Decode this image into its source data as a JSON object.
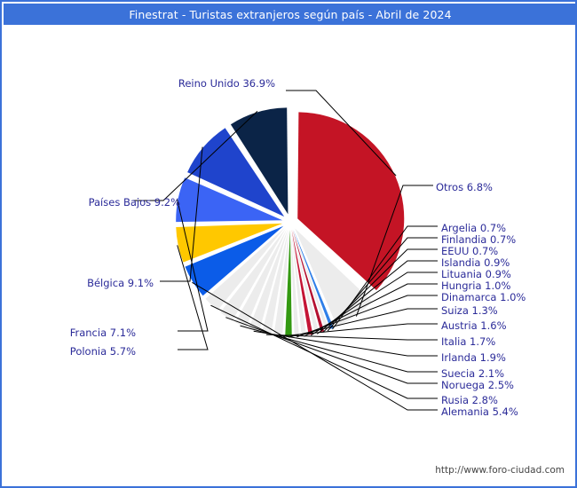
{
  "window": {
    "title": "Finestrat - Turistas extranjeros según país - Abril de 2024"
  },
  "footer": {
    "watermark": "http://www.foro-ciudad.com"
  },
  "colors": {
    "header_bg": "#3b72d9",
    "header_text": "#ffffff",
    "border": "#3b72d9",
    "label_text": "#2b2b99",
    "leader_line": "#000000",
    "background": "#ffffff"
  },
  "chart_data": {
    "type": "pie",
    "title": "Finestrat - Turistas extranjeros según país - Abril de 2024",
    "xlabel": "",
    "ylabel": "",
    "legend_position": "none",
    "grid": false,
    "exploded": true,
    "start_angle_deg": 0,
    "direction": "clockwise",
    "categories": [
      "Reino Unido",
      "Otros",
      "Argelia",
      "Finlandia",
      "EEUU",
      "Islandia",
      "Lituania",
      "Hungria",
      "Dinamarca",
      "Suiza",
      "Austria",
      "Italia",
      "Irlanda",
      "Suecia",
      "Noruega",
      "Rusia",
      "Alemania",
      "Polonia",
      "Francia",
      "Bélgica",
      "Países Bajos"
    ],
    "values": [
      36.9,
      6.8,
      0.7,
      0.7,
      0.7,
      0.9,
      0.9,
      1.0,
      1.0,
      1.3,
      1.6,
      1.7,
      1.9,
      2.1,
      2.5,
      2.8,
      5.4,
      5.7,
      7.1,
      9.1,
      9.2
    ],
    "unit": "%",
    "slices": [
      {
        "label": "Reino Unido 36.9%",
        "name": "Reino Unido",
        "value": 36.9,
        "color": "#c41425",
        "side": "top"
      },
      {
        "label": "Otros 6.8%",
        "name": "Otros",
        "value": 6.8,
        "color": "#ececec",
        "side": "right"
      },
      {
        "label": "Argelia 0.7%",
        "name": "Argelia",
        "value": 0.7,
        "color": "#2f7fe8",
        "side": "right"
      },
      {
        "label": "Finlandia 0.7%",
        "name": "Finlandia",
        "value": 0.7,
        "color": "#ececec",
        "side": "right"
      },
      {
        "label": "EEUU 0.7%",
        "name": "EEUU",
        "value": 0.7,
        "color": "#b41030",
        "side": "right"
      },
      {
        "label": "Islandia 0.9%",
        "name": "Islandia",
        "value": 0.9,
        "color": "#ececec",
        "side": "right"
      },
      {
        "label": "Lituania 0.9%",
        "name": "Lituania",
        "value": 0.9,
        "color": "#c41435",
        "side": "right"
      },
      {
        "label": "Hungria 1.0%",
        "name": "Hungria",
        "value": 1.0,
        "color": "#ececec",
        "side": "right"
      },
      {
        "label": "Dinamarca 1.0%",
        "name": "Dinamarca",
        "value": 1.0,
        "color": "#ececec",
        "side": "right"
      },
      {
        "label": "Suiza 1.3%",
        "name": "Suiza",
        "value": 1.3,
        "color": "#339911",
        "side": "right"
      },
      {
        "label": "Austria 1.6%",
        "name": "Austria",
        "value": 1.6,
        "color": "#ececec",
        "side": "right"
      },
      {
        "label": "Italia 1.7%",
        "name": "Italia",
        "value": 1.7,
        "color": "#ececec",
        "side": "right"
      },
      {
        "label": "Irlanda 1.9%",
        "name": "Irlanda",
        "value": 1.9,
        "color": "#ececec",
        "side": "right"
      },
      {
        "label": "Suecia 2.1%",
        "name": "Suecia",
        "value": 2.1,
        "color": "#ececec",
        "side": "right"
      },
      {
        "label": "Noruega 2.5%",
        "name": "Noruega",
        "value": 2.5,
        "color": "#ececec",
        "side": "right"
      },
      {
        "label": "Rusia 2.8%",
        "name": "Rusia",
        "value": 2.8,
        "color": "#ececec",
        "side": "right"
      },
      {
        "label": "Alemania 5.4%",
        "name": "Alemania",
        "value": 5.4,
        "color": "#0b5ce8",
        "side": "right"
      },
      {
        "label": "Polonia 5.7%",
        "name": "Polonia",
        "value": 5.7,
        "color": "#ffc800",
        "side": "left"
      },
      {
        "label": "Francia 7.1%",
        "name": "Francia",
        "value": 7.1,
        "color": "#3b64f5",
        "side": "left"
      },
      {
        "label": "Bélgica 9.1%",
        "name": "Bélgica",
        "value": 9.1,
        "color": "#1f44cc",
        "side": "left"
      },
      {
        "label": "Países Bajos 9.2%",
        "name": "Países Bajos",
        "value": 9.2,
        "color": "#ececec",
        "side": "left"
      },
      {
        "label": "",
        "name": "Países Bajos navy",
        "value": 0,
        "color": "#0b2447",
        "side": "left"
      }
    ]
  },
  "labels": {
    "reino_unido": "Reino Unido 36.9%",
    "paises_bajos": "Países Bajos 9.2%",
    "belgica": "Bélgica 9.1%",
    "francia": "Francia 7.1%",
    "polonia": "Polonia 5.7%",
    "otros": "Otros 6.8%",
    "argelia": "Argelia 0.7%",
    "finlandia": "Finlandia 0.7%",
    "eeuu": "EEUU 0.7%",
    "islandia": "Islandia 0.9%",
    "lituania": "Lituania 0.9%",
    "hungria": "Hungria 1.0%",
    "dinamarca": "Dinamarca 1.0%",
    "suiza": "Suiza 1.3%",
    "austria": "Austria 1.6%",
    "italia": "Italia 1.7%",
    "irlanda": "Irlanda 1.9%",
    "suecia": "Suecia 2.1%",
    "noruega": "Noruega 2.5%",
    "rusia": "Rusia 2.8%",
    "alemania": "Alemania 5.4%"
  }
}
